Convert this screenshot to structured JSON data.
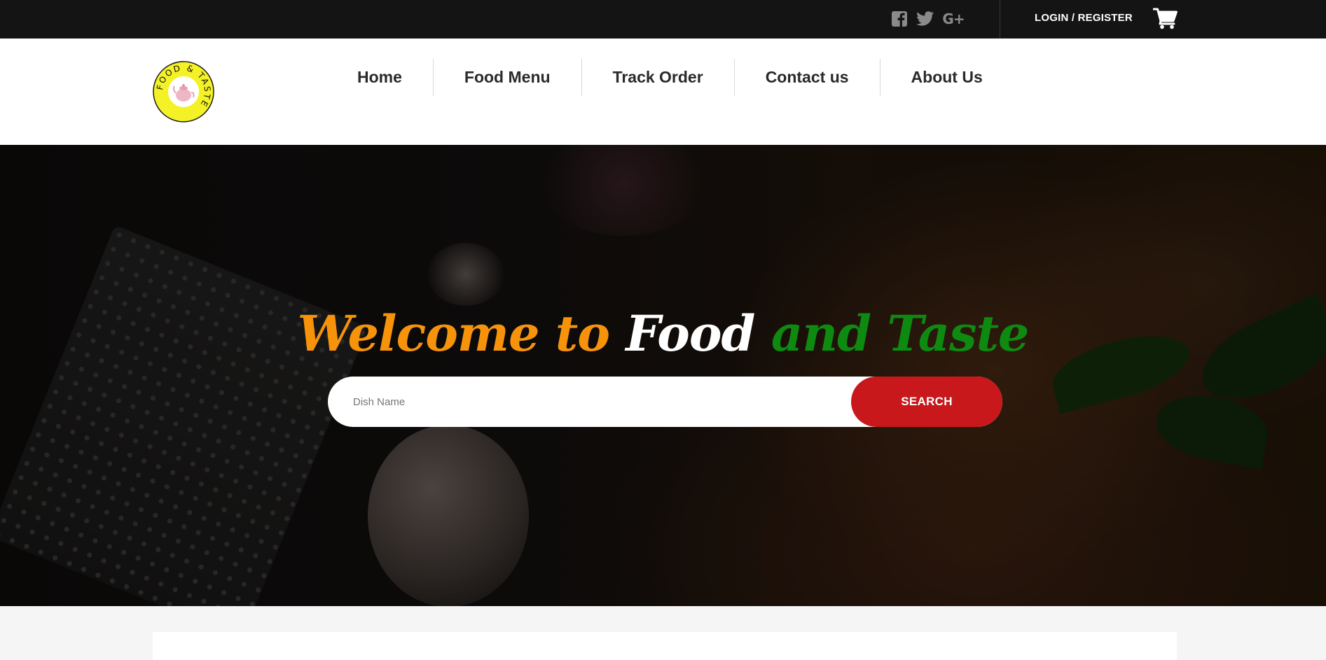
{
  "topbar": {
    "social": [
      {
        "icon": "facebook-icon"
      },
      {
        "icon": "twitter-icon"
      },
      {
        "icon": "google-plus-icon",
        "label": "G+"
      }
    ],
    "login_label": "LOGIN / REGISTER",
    "cart_icon": "cart-icon"
  },
  "header": {
    "logo_text": "FOOD & TASTE",
    "nav": [
      {
        "label": "Home"
      },
      {
        "label": "Food Menu"
      },
      {
        "label": "Track Order"
      },
      {
        "label": "Contact us"
      },
      {
        "label": "About Us"
      }
    ]
  },
  "hero": {
    "title_part1": "Welcome to",
    "title_part2": "Food",
    "title_part3": "and Taste",
    "search_placeholder": "Dish Name",
    "search_button": "SEARCH"
  },
  "colors": {
    "topbar_bg": "#141414",
    "accent_orange": "#f6930b",
    "accent_green": "#0e8a10",
    "search_red": "#c8181b",
    "logo_yellow": "#f4f227"
  }
}
